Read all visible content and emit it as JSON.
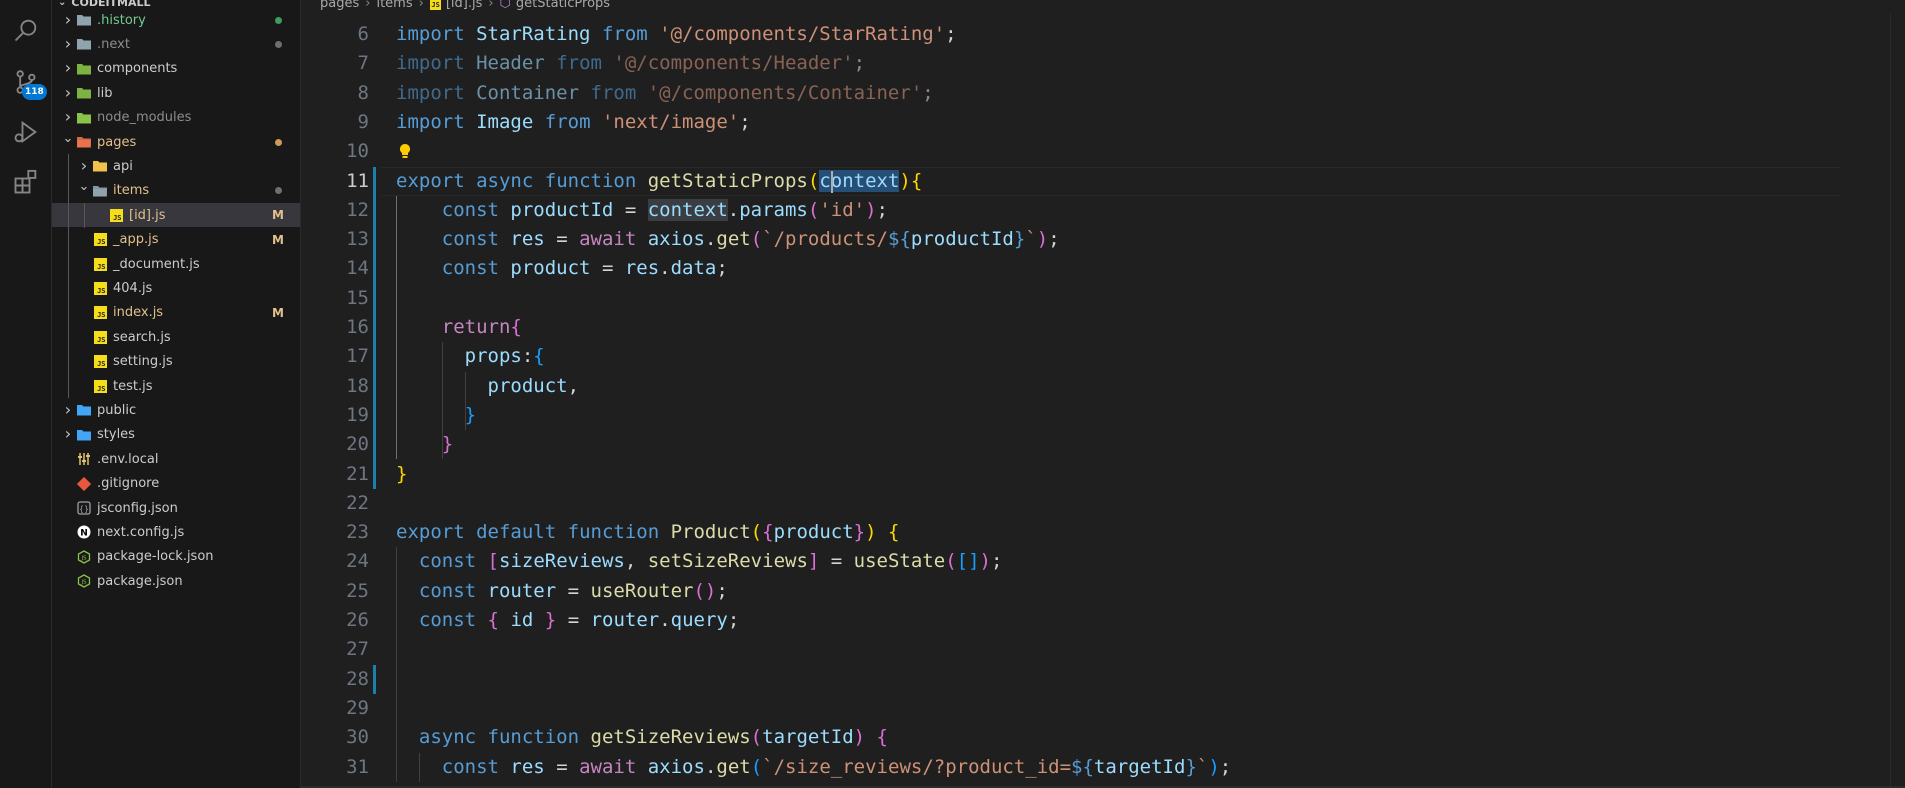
{
  "activity_bar": {
    "items": [
      {
        "name": "search-icon"
      },
      {
        "name": "source-control-icon",
        "badge": "118"
      },
      {
        "name": "run-debug-icon"
      },
      {
        "name": "extensions-icon"
      }
    ]
  },
  "explorer": {
    "root_label": "CODEITMALL",
    "items": [
      {
        "label": ".history",
        "type": "folder",
        "expanded": false,
        "depth": 0,
        "status_dot": "#3c9d5d"
      },
      {
        "label": ".next",
        "type": "folder",
        "expanded": false,
        "depth": 0,
        "status_dot": "#6f6f6f"
      },
      {
        "label": "components",
        "type": "folder",
        "expanded": false,
        "depth": 0
      },
      {
        "label": "lib",
        "type": "folder",
        "expanded": false,
        "depth": 0
      },
      {
        "label": "node_modules",
        "type": "folder",
        "expanded": false,
        "depth": 0
      },
      {
        "label": "pages",
        "type": "folder",
        "expanded": true,
        "depth": 0,
        "status_dot": "#d09b5a"
      },
      {
        "label": "api",
        "type": "folder",
        "expanded": false,
        "depth": 1
      },
      {
        "label": "items",
        "type": "folder",
        "expanded": true,
        "depth": 1,
        "status_dot": "#6f6f6f"
      },
      {
        "label": "[id].js",
        "type": "js",
        "depth": 2,
        "status": "M",
        "selected": true
      },
      {
        "label": "_app.js",
        "type": "js",
        "depth": 1,
        "status": "M"
      },
      {
        "label": "_document.js",
        "type": "js",
        "depth": 1
      },
      {
        "label": "404.js",
        "type": "js",
        "depth": 1
      },
      {
        "label": "index.js",
        "type": "js",
        "depth": 1,
        "status": "M"
      },
      {
        "label": "search.js",
        "type": "js",
        "depth": 1
      },
      {
        "label": "setting.js",
        "type": "js",
        "depth": 1
      },
      {
        "label": "test.js",
        "type": "js",
        "depth": 1
      },
      {
        "label": "public",
        "type": "folder",
        "expanded": false,
        "depth": 0
      },
      {
        "label": "styles",
        "type": "folder",
        "expanded": false,
        "depth": 0
      },
      {
        "label": ".env.local",
        "type": "env",
        "depth": 0
      },
      {
        "label": ".gitignore",
        "type": "git",
        "depth": 0
      },
      {
        "label": "jsconfig.json",
        "type": "json",
        "depth": 0
      },
      {
        "label": "next.config.js",
        "type": "next",
        "depth": 0
      },
      {
        "label": "package-lock.json",
        "type": "npm",
        "depth": 0
      },
      {
        "label": "package.json",
        "type": "npm",
        "depth": 0
      }
    ]
  },
  "breadcrumb": [
    "pages",
    "items",
    "[id].js",
    "getStaticProps"
  ],
  "editor": {
    "lines": [
      {
        "n": "6",
        "tokens": [
          [
            "kw",
            "import"
          ],
          [
            "plain",
            " "
          ],
          [
            "var",
            "StarRating"
          ],
          [
            "plain",
            " "
          ],
          [
            "kw",
            "from"
          ],
          [
            "plain",
            " "
          ],
          [
            "str",
            "'@/components/StarRating'"
          ],
          [
            "plain",
            ";"
          ]
        ]
      },
      {
        "n": "7",
        "dim": true,
        "tokens": [
          [
            "kw",
            "import"
          ],
          [
            "plain",
            " "
          ],
          [
            "var",
            "Header"
          ],
          [
            "plain",
            " "
          ],
          [
            "kw",
            "from"
          ],
          [
            "plain",
            " "
          ],
          [
            "str",
            "'@/components/Header'"
          ],
          [
            "plain",
            ";"
          ]
        ]
      },
      {
        "n": "8",
        "dim": true,
        "tokens": [
          [
            "kw",
            "import"
          ],
          [
            "plain",
            " "
          ],
          [
            "var",
            "Container"
          ],
          [
            "plain",
            " "
          ],
          [
            "kw",
            "from"
          ],
          [
            "plain",
            " "
          ],
          [
            "str",
            "'@/components/Container'"
          ],
          [
            "plain",
            ";"
          ]
        ]
      },
      {
        "n": "9",
        "tokens": [
          [
            "kw",
            "import"
          ],
          [
            "plain",
            " "
          ],
          [
            "var",
            "Image"
          ],
          [
            "plain",
            " "
          ],
          [
            "kw",
            "from"
          ],
          [
            "plain",
            " "
          ],
          [
            "str",
            "'next/image'"
          ],
          [
            "plain",
            ";"
          ]
        ]
      },
      {
        "n": "10",
        "tokens": []
      },
      {
        "n": "11",
        "active": true,
        "tokens": [
          [
            "kw",
            "export"
          ],
          [
            "plain",
            " "
          ],
          [
            "kw",
            "async"
          ],
          [
            "plain",
            " "
          ],
          [
            "kw",
            "function"
          ],
          [
            "plain",
            " "
          ],
          [
            "fn",
            "getStaticProps"
          ],
          [
            "b1",
            "("
          ],
          [
            "var sel",
            "context"
          ],
          [
            "b1",
            ")"
          ],
          [
            "b1",
            "{"
          ]
        ]
      },
      {
        "n": "12",
        "tokens": [
          [
            "plain",
            "    "
          ],
          [
            "kw",
            "const"
          ],
          [
            "plain",
            " "
          ],
          [
            "var",
            "productId"
          ],
          [
            "plain",
            " = "
          ],
          [
            "var hl",
            "context"
          ],
          [
            "plain",
            "."
          ],
          [
            "var",
            "params"
          ],
          [
            "b2",
            "("
          ],
          [
            "str",
            "'id'"
          ],
          [
            "b2",
            ")"
          ],
          [
            "plain",
            ";"
          ]
        ]
      },
      {
        "n": "13",
        "tokens": [
          [
            "plain",
            "    "
          ],
          [
            "kw",
            "const"
          ],
          [
            "plain",
            " "
          ],
          [
            "var",
            "res"
          ],
          [
            "plain",
            " = "
          ],
          [
            "ctl",
            "await"
          ],
          [
            "plain",
            " "
          ],
          [
            "var",
            "axios"
          ],
          [
            "plain",
            "."
          ],
          [
            "fn",
            "get"
          ],
          [
            "b2",
            "("
          ],
          [
            "str",
            "`/products/"
          ],
          [
            "tpl-punc",
            "${"
          ],
          [
            "var",
            "productId"
          ],
          [
            "tpl-punc",
            "}"
          ],
          [
            "str",
            "`"
          ],
          [
            "b2",
            ")"
          ],
          [
            "plain",
            ";"
          ]
        ]
      },
      {
        "n": "14",
        "tokens": [
          [
            "plain",
            "    "
          ],
          [
            "kw",
            "const"
          ],
          [
            "plain",
            " "
          ],
          [
            "var",
            "product"
          ],
          [
            "plain",
            " = "
          ],
          [
            "var",
            "res"
          ],
          [
            "plain",
            "."
          ],
          [
            "var",
            "data"
          ],
          [
            "plain",
            ";"
          ]
        ]
      },
      {
        "n": "15",
        "tokens": []
      },
      {
        "n": "16",
        "tokens": [
          [
            "plain",
            "    "
          ],
          [
            "ctl",
            "return"
          ],
          [
            "b2",
            "{"
          ]
        ]
      },
      {
        "n": "17",
        "tokens": [
          [
            "plain",
            "      "
          ],
          [
            "var",
            "props"
          ],
          [
            "plain",
            ":"
          ],
          [
            "b3",
            "{"
          ]
        ]
      },
      {
        "n": "18",
        "tokens": [
          [
            "plain",
            "        "
          ],
          [
            "var",
            "product"
          ],
          [
            "plain",
            ","
          ]
        ]
      },
      {
        "n": "19",
        "tokens": [
          [
            "plain",
            "      "
          ],
          [
            "b3",
            "}"
          ]
        ]
      },
      {
        "n": "20",
        "tokens": [
          [
            "plain",
            "    "
          ],
          [
            "b2",
            "}"
          ]
        ]
      },
      {
        "n": "21",
        "tokens": [
          [
            "b1",
            "}"
          ]
        ]
      },
      {
        "n": "22",
        "tokens": []
      },
      {
        "n": "23",
        "tokens": [
          [
            "kw",
            "export"
          ],
          [
            "plain",
            " "
          ],
          [
            "kw",
            "default"
          ],
          [
            "plain",
            " "
          ],
          [
            "kw",
            "function"
          ],
          [
            "plain",
            " "
          ],
          [
            "fn",
            "Product"
          ],
          [
            "b1",
            "("
          ],
          [
            "b2",
            "{"
          ],
          [
            "var",
            "product"
          ],
          [
            "b2",
            "}"
          ],
          [
            "b1",
            ")"
          ],
          [
            "plain",
            " "
          ],
          [
            "b1",
            "{"
          ]
        ]
      },
      {
        "n": "24",
        "tokens": [
          [
            "plain",
            "  "
          ],
          [
            "kw",
            "const"
          ],
          [
            "plain",
            " "
          ],
          [
            "b2",
            "["
          ],
          [
            "var",
            "sizeReviews"
          ],
          [
            "plain",
            ", "
          ],
          [
            "fn",
            "setSizeReviews"
          ],
          [
            "b2",
            "]"
          ],
          [
            "plain",
            " = "
          ],
          [
            "fn",
            "useState"
          ],
          [
            "b2",
            "("
          ],
          [
            "b3",
            "[]"
          ],
          [
            "b2",
            ")"
          ],
          [
            "plain",
            ";"
          ]
        ]
      },
      {
        "n": "25",
        "tokens": [
          [
            "plain",
            "  "
          ],
          [
            "kw",
            "const"
          ],
          [
            "plain",
            " "
          ],
          [
            "var",
            "router"
          ],
          [
            "plain",
            " = "
          ],
          [
            "fn",
            "useRouter"
          ],
          [
            "b2",
            "()"
          ],
          [
            "plain",
            ";"
          ]
        ]
      },
      {
        "n": "26",
        "tokens": [
          [
            "plain",
            "  "
          ],
          [
            "kw",
            "const"
          ],
          [
            "plain",
            " "
          ],
          [
            "b2",
            "{"
          ],
          [
            "plain",
            " "
          ],
          [
            "var",
            "id"
          ],
          [
            "plain",
            " "
          ],
          [
            "b2",
            "}"
          ],
          [
            "plain",
            " = "
          ],
          [
            "var",
            "router"
          ],
          [
            "plain",
            "."
          ],
          [
            "var",
            "query"
          ],
          [
            "plain",
            ";"
          ]
        ]
      },
      {
        "n": "27",
        "tokens": []
      },
      {
        "n": "28",
        "tokens": []
      },
      {
        "n": "29",
        "tokens": []
      },
      {
        "n": "30",
        "tokens": [
          [
            "plain",
            "  "
          ],
          [
            "kw",
            "async"
          ],
          [
            "plain",
            " "
          ],
          [
            "kw",
            "function"
          ],
          [
            "plain",
            " "
          ],
          [
            "fn",
            "getSizeReviews"
          ],
          [
            "b2",
            "("
          ],
          [
            "var",
            "targetId"
          ],
          [
            "b2",
            ")"
          ],
          [
            "plain",
            " "
          ],
          [
            "b2",
            "{"
          ]
        ]
      },
      {
        "n": "31",
        "tokens": [
          [
            "plain",
            "    "
          ],
          [
            "kw",
            "const"
          ],
          [
            "plain",
            " "
          ],
          [
            "var",
            "res"
          ],
          [
            "plain",
            " = "
          ],
          [
            "ctl",
            "await"
          ],
          [
            "plain",
            " "
          ],
          [
            "var",
            "axios"
          ],
          [
            "plain",
            "."
          ],
          [
            "fn",
            "get"
          ],
          [
            "b3",
            "("
          ],
          [
            "str",
            "`/size_reviews/?product_id="
          ],
          [
            "tpl-punc",
            "${"
          ],
          [
            "var",
            "targetId"
          ],
          [
            "tpl-punc",
            "}"
          ],
          [
            "str",
            "`"
          ],
          [
            "b3",
            ")"
          ],
          [
            "plain",
            ";"
          ]
        ]
      }
    ]
  },
  "colors": {
    "accent": "#0078d4",
    "modified": "#e2c08d",
    "folder": "#90a4ae",
    "folder_open": "#e8a34c"
  }
}
